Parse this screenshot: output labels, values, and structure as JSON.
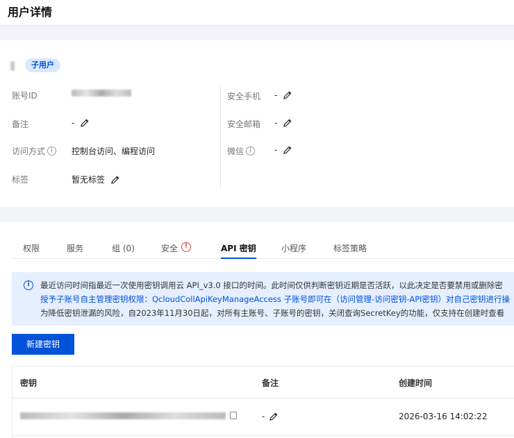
{
  "page": {
    "title": "用户详情"
  },
  "user": {
    "badge": "子用户",
    "fields_left": [
      {
        "label": "账号ID",
        "value": ""
      },
      {
        "label": "备注",
        "value": "-"
      },
      {
        "label": "访问方式",
        "value": "控制台访问、编程访问"
      },
      {
        "label": "标签",
        "value": "暂无标签"
      }
    ],
    "fields_right": [
      {
        "label": "安全手机",
        "value": "-"
      },
      {
        "label": "安全邮箱",
        "value": "-"
      },
      {
        "label": "微信",
        "value": "-"
      }
    ]
  },
  "tabs": [
    {
      "label": "权限"
    },
    {
      "label": "服务"
    },
    {
      "label": "组 (0)"
    },
    {
      "label": "安全"
    },
    {
      "label": "API 密钥"
    },
    {
      "label": "小程序"
    },
    {
      "label": "标签策略"
    }
  ],
  "notice": {
    "line1": "最近访问时间指最近一次使用密钥调用云 API_v3.0 接口的时间。此时间仅供判断密钥近期是否活跃，以此决定是否要禁用或删除密",
    "line2": "授予子账号自主管理密钥权限：QcloudCollApiKeyManageAccess 子账号即可在（访问管理-访问密钥-API密钥）对自己密钥进行操",
    "line3": "为降低密钥泄漏的风险，自2023年11月30日起，对所有主账号、子账号的密钥，关闭查询SecretKey的功能，仅支持在创建时查看"
  },
  "create_button": "新建密钥",
  "table": {
    "headers": [
      "密钥",
      "备注",
      "创建时间"
    ],
    "rows": [
      {
        "key": "",
        "remark": "-",
        "created": "2026-03-16 14:02:22"
      }
    ]
  },
  "icons": [
    "info-icon",
    "pencil-icon",
    "warning-icon",
    "copy-icon"
  ],
  "colors": {
    "primary": "#0052d9",
    "badge_bg": "#d9e8fd",
    "notice_bg": "#e5efff",
    "warning": "#e54545"
  }
}
